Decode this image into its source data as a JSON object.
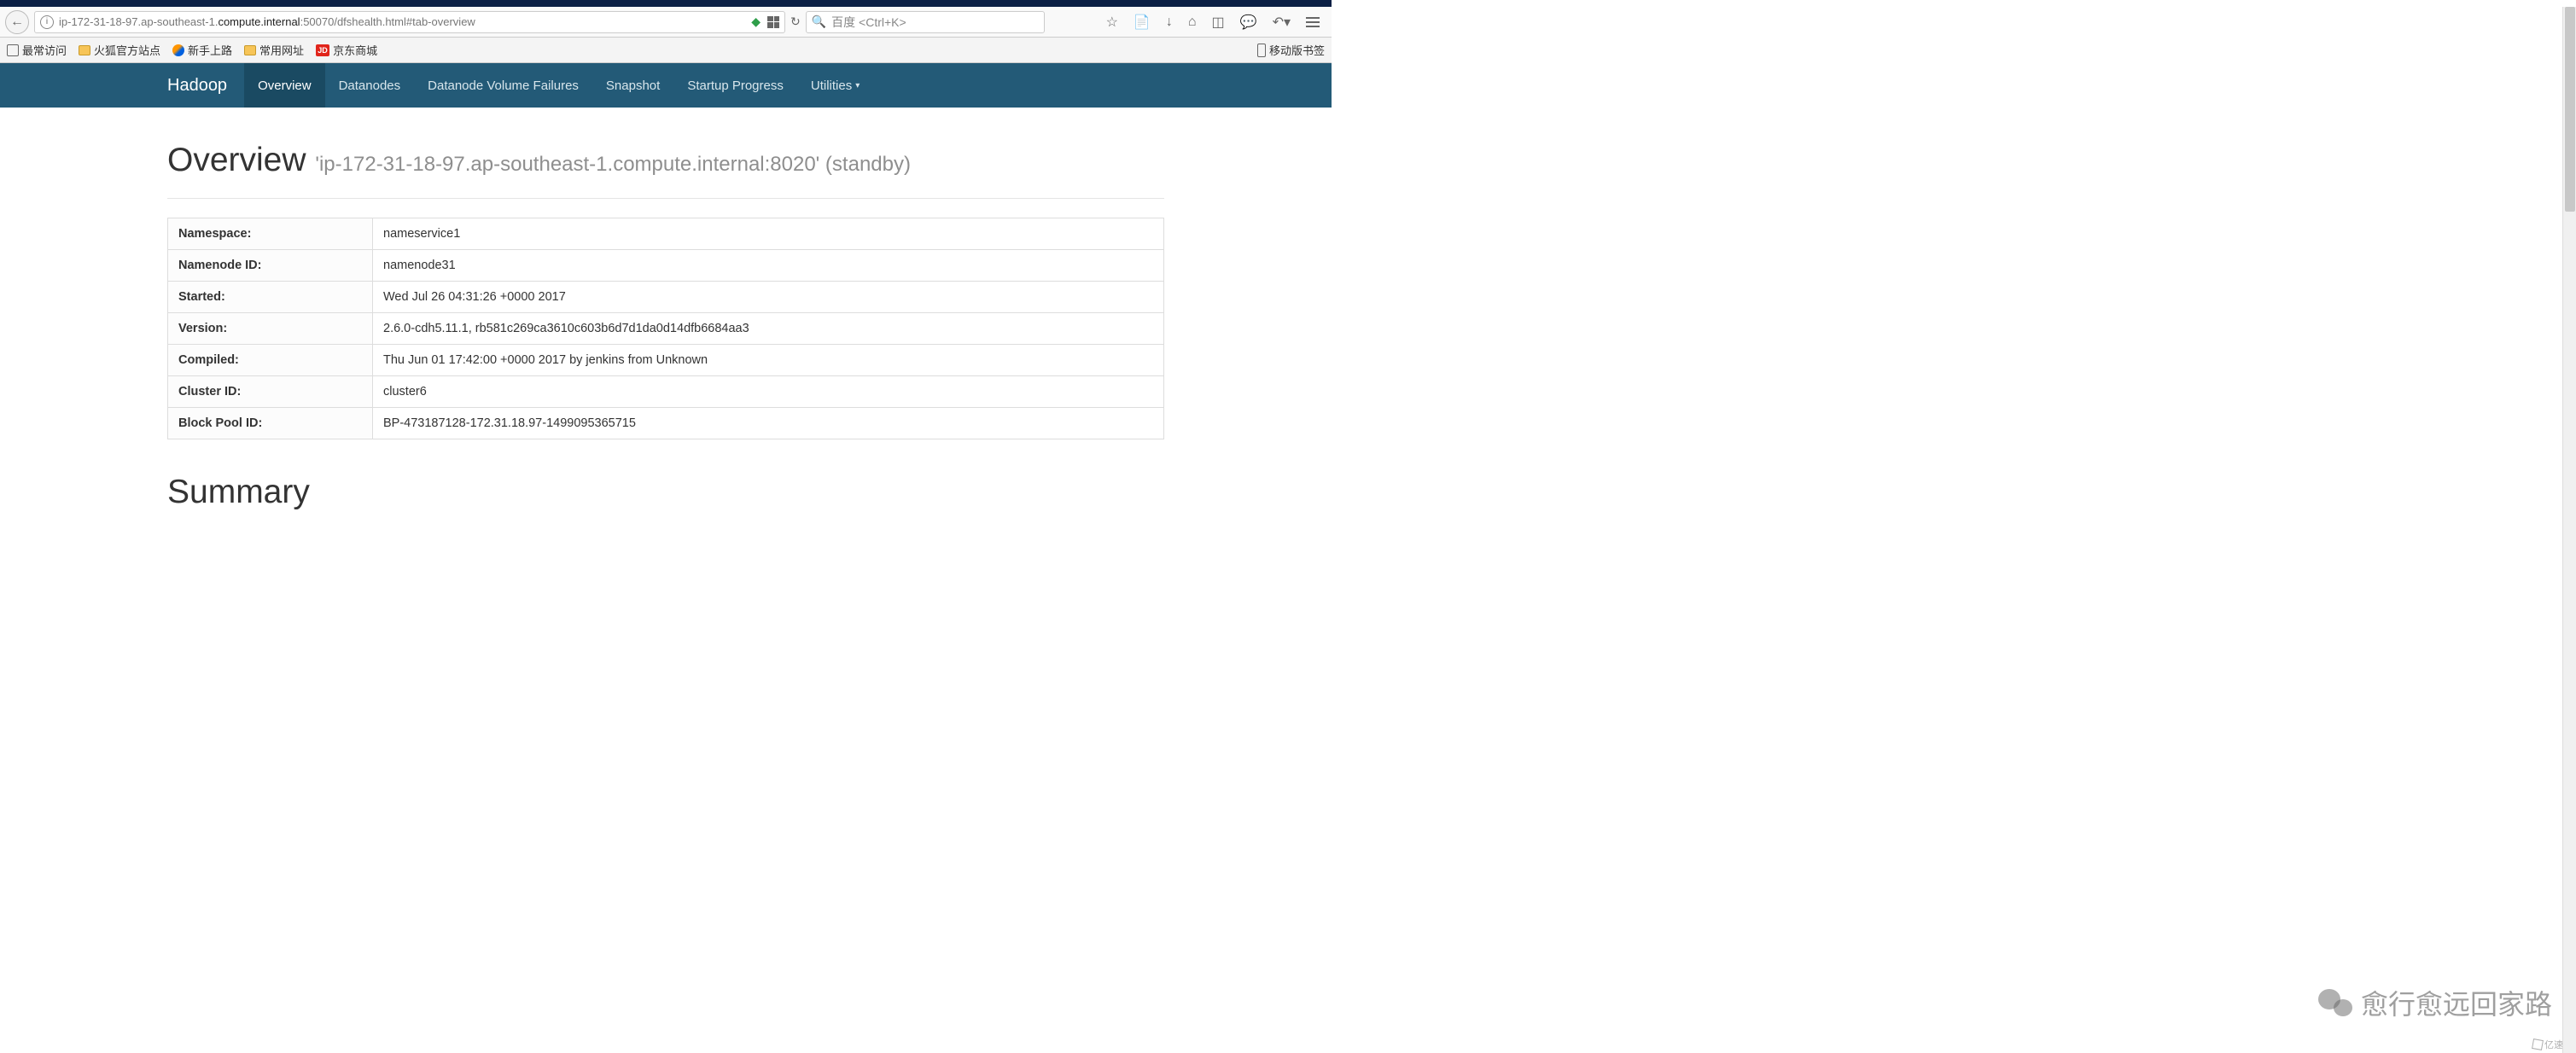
{
  "browser": {
    "url_prefix": "ip-172-31-18-97.ap-southeast-1.",
    "url_host": "compute.internal",
    "url_suffix": ":50070/dfshealth.html#tab-overview",
    "search_placeholder": "百度 <Ctrl+K>"
  },
  "bookmarks": {
    "most_visited": "最常访问",
    "firefox_official": "火狐官方站点",
    "getting_started": "新手上路",
    "common_urls": "常用网址",
    "jd_label": "JD",
    "jd_text": "京东商城",
    "mobile_bookmarks": "移动版书签"
  },
  "nav": {
    "brand": "Hadoop",
    "overview": "Overview",
    "datanodes": "Datanodes",
    "dvf": "Datanode Volume Failures",
    "snapshot": "Snapshot",
    "startup": "Startup Progress",
    "utilities": "Utilities"
  },
  "page": {
    "title": "Overview",
    "subtitle": "'ip-172-31-18-97.ap-southeast-1.compute.internal:8020' (standby)",
    "summary_heading": "Summary"
  },
  "info_rows": [
    {
      "label": "Namespace:",
      "value": "nameservice1"
    },
    {
      "label": "Namenode ID:",
      "value": "namenode31"
    },
    {
      "label": "Started:",
      "value": "Wed Jul 26 04:31:26 +0000 2017"
    },
    {
      "label": "Version:",
      "value": "2.6.0-cdh5.11.1, rb581c269ca3610c603b6d7d1da0d14dfb6684aa3"
    },
    {
      "label": "Compiled:",
      "value": "Thu Jun 01 17:42:00 +0000 2017 by jenkins from Unknown"
    },
    {
      "label": "Cluster ID:",
      "value": "cluster6"
    },
    {
      "label": "Block Pool ID:",
      "value": "BP-473187128-172.31.18.97-1499095365715"
    }
  ],
  "watermark": {
    "wechat_text": "愈行愈远回家路",
    "corner_text": "亿速云"
  }
}
